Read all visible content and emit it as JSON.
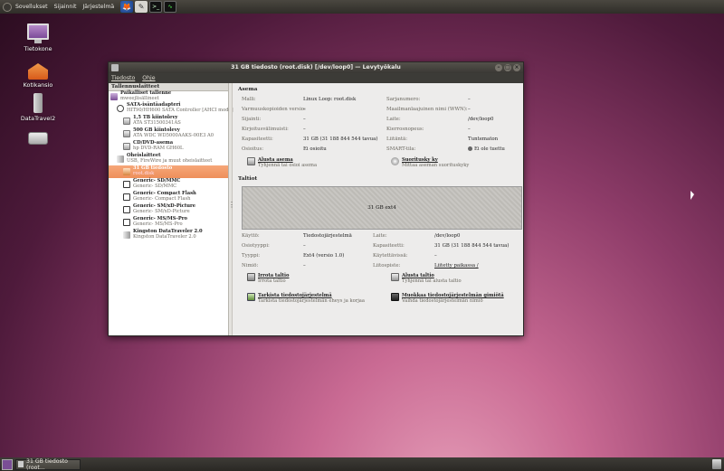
{
  "top_panel": {
    "menus": [
      "Sovellukset",
      "Sijainnit",
      "Järjestelmä"
    ],
    "launchers": [
      {
        "name": "firefox-icon",
        "glyph": "🦊"
      },
      {
        "name": "gimp-icon",
        "glyph": "✎"
      },
      {
        "name": "terminal-icon",
        "glyph": ">_"
      },
      {
        "name": "system-monitor-icon",
        "glyph": "∿"
      }
    ]
  },
  "desktop": {
    "icons": [
      {
        "label": "Tietokone"
      },
      {
        "label": "Kotikansio"
      },
      {
        "label": "DataTravel2"
      },
      {
        "label": ""
      }
    ]
  },
  "window": {
    "title": "31 GB tiedosto (root.disk) [/dev/loop0] — Levytyökalu",
    "menu": [
      "Tiedosto",
      "Ohje"
    ]
  },
  "sidebar": {
    "header": "Tallennuslaitteet",
    "items": [
      {
        "title": "Paikalliset tallenne",
        "sub": "mweejlisällineet"
      },
      {
        "title": "SATA-isäntäadapteri",
        "sub": "HIT90/HH600 SATA Controller [AHCI mode]"
      },
      {
        "title": "1,5 TB kiintolevy",
        "sub": "ATA ST31500341AS"
      },
      {
        "title": "500 GB kiintolevy",
        "sub": "ATA WDC WD5000AAKS-00E3 A0"
      },
      {
        "title": "CD/DVD-asema",
        "sub": "hp DVD-RAM GH60L"
      },
      {
        "title": "Oheislaitteet",
        "sub": "USB, FireWire ja muut oheislaitteet"
      },
      {
        "title": "31 GB tiedosto",
        "sub": "root.disk"
      },
      {
        "title": "Generic- SD/MMC",
        "sub": "Generic- SD/MMC"
      },
      {
        "title": "Generic- Compact Flash",
        "sub": "Generic- Compact Flash"
      },
      {
        "title": "Generic- SM/xD-Picture",
        "sub": "Generic- SM/xD-Picture"
      },
      {
        "title": "Generic- MS/MS-Pro",
        "sub": "Generic- MS/MS-Pro"
      },
      {
        "title": "Kingston DataTraveler 2.0",
        "sub": "Kingston DataTraveler 2.0"
      }
    ]
  },
  "drive": {
    "section_title": "Asema",
    "left": [
      {
        "k": "Malli:",
        "v": "Linux Loop: root.disk"
      },
      {
        "k": "Varmuuskopioiden versio:",
        "v": "–"
      },
      {
        "k": "Sijainti:",
        "v": "–"
      },
      {
        "k": "Kirjoitusvälimuisti:",
        "v": "–"
      },
      {
        "k": "Kapasiteetti:",
        "v": "31 GB (31 188 844 544 tavua)"
      },
      {
        "k": "Osioitus:",
        "v": "Ei osioitu"
      }
    ],
    "right": [
      {
        "k": "Sarjanumero:",
        "v": "–"
      },
      {
        "k": "Maailmanlaajuinen nimi (WWN):",
        "v": "–"
      },
      {
        "k": "Laite:",
        "v": "/dev/loop0"
      },
      {
        "k": "Kierrosnopeus:",
        "v": "–"
      },
      {
        "k": "Liitäntä:",
        "v": "Tuntematon"
      },
      {
        "k": "SMART-tila:",
        "v": "Ei ole tuettu"
      }
    ],
    "actions": [
      {
        "label": "Alusta asema",
        "sub": "Tyhjennä tai osioi asema"
      },
      {
        "label": "Suoritusky ky",
        "sub": "Mittaa aseman suorituskyky"
      }
    ]
  },
  "volumes": {
    "section_title": "Taltiot",
    "bar_label": "31 GB ext4",
    "left": [
      {
        "k": "Käyttö:",
        "v": "Tiedostojärjestelmä"
      },
      {
        "k": "Osiotyyppi:",
        "v": "–"
      },
      {
        "k": "Tyyppi:",
        "v": "Ext4 (versio 1.0)"
      },
      {
        "k": "Nimiö:",
        "v": "–"
      }
    ],
    "right": [
      {
        "k": "Laite:",
        "v": "/dev/loop0"
      },
      {
        "k": "Kapasiteetti:",
        "v": "31 GB (31 188 844 544 tavua)"
      },
      {
        "k": "Käytettävissä:",
        "v": "–"
      },
      {
        "k": "Liitospiste:",
        "v": "Liitetty paikassa /"
      }
    ],
    "actions": [
      {
        "label": "Irrota taltio",
        "sub": "Irrota taltio"
      },
      {
        "label": "Alusta taltio",
        "sub": "Tyhjennä tai alusta taltio"
      },
      {
        "label": "Tarkista tiedostojärjestelmä",
        "sub": "Tarkista tiedostojärjestelmän eheys ja korjaa"
      },
      {
        "label": "Muokkaa tiedostojärjestelmän gimiötä",
        "sub": "Vaihda tiedostojärjestelmän nimiö"
      }
    ]
  },
  "taskbar": {
    "task_label": "31 GB tiedosto (root..."
  }
}
